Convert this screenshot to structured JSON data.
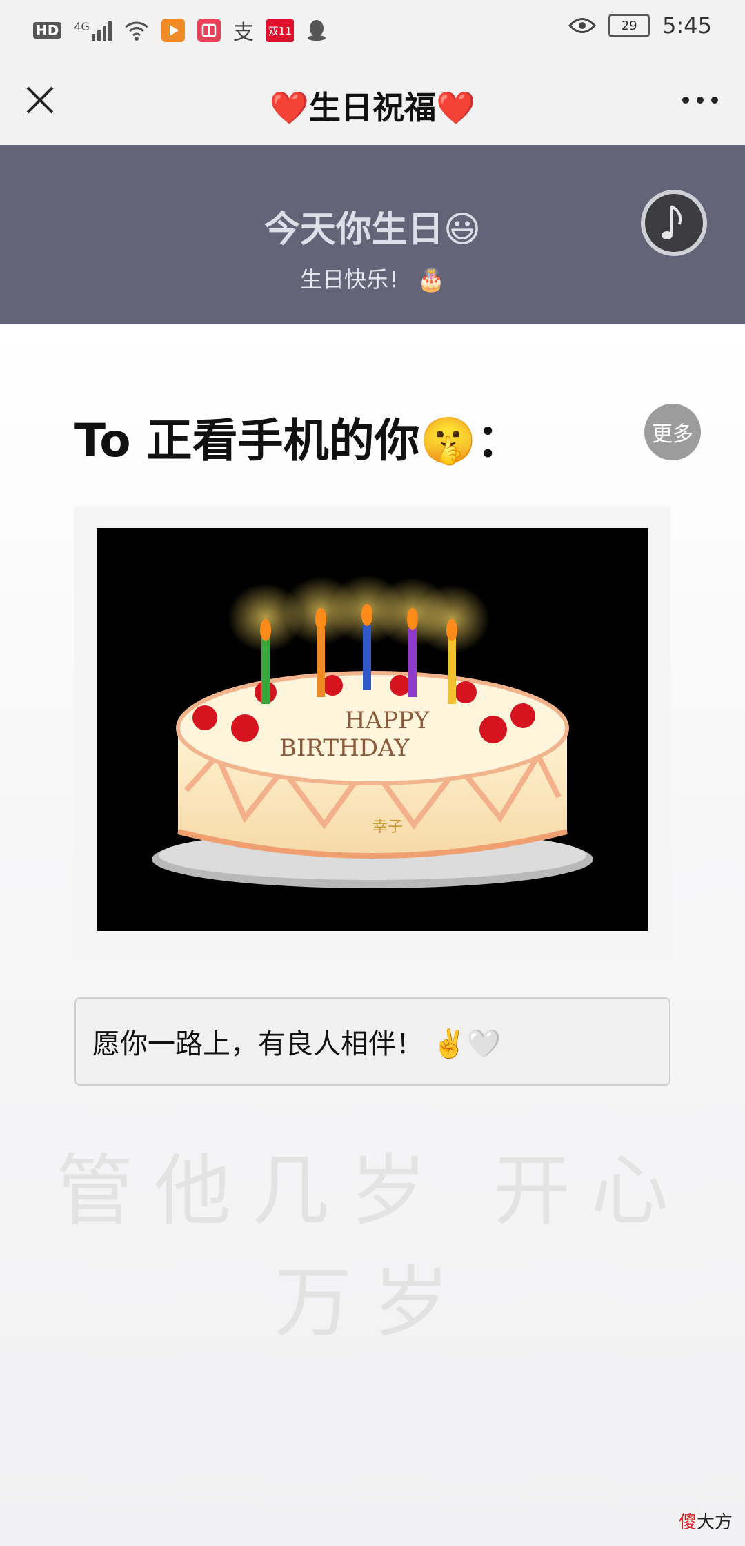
{
  "status_bar": {
    "left_icons": [
      "hd-icon",
      "signal-4g-icon",
      "wifi-icon",
      "video-app-icon",
      "book-app-icon",
      "alipay-icon",
      "double11-icon",
      "qq-icon"
    ],
    "hd": "HD",
    "net": "4G",
    "alipay": "支",
    "double11": "双11",
    "battery_level": "29",
    "time": "5:45"
  },
  "title_bar": {
    "title": "❤️生日祝福❤️"
  },
  "banner": {
    "title": "今天你生日😃",
    "subtitle": "生日快乐！ 🎂",
    "bg_color": "#646478"
  },
  "greeting": {
    "text": "To 正看手机的你🤫：",
    "more_label": "更多"
  },
  "cake": {
    "line1": "HAPPY",
    "line2": "BIRTHDAY",
    "name": "幸子"
  },
  "wish": {
    "text": "愿你一路上，有良人相伴！ ✌️🤍"
  },
  "watermark": {
    "text": "管他几岁  开心万岁"
  },
  "corner_logo": {
    "red": "傻",
    "rest": "大方"
  }
}
